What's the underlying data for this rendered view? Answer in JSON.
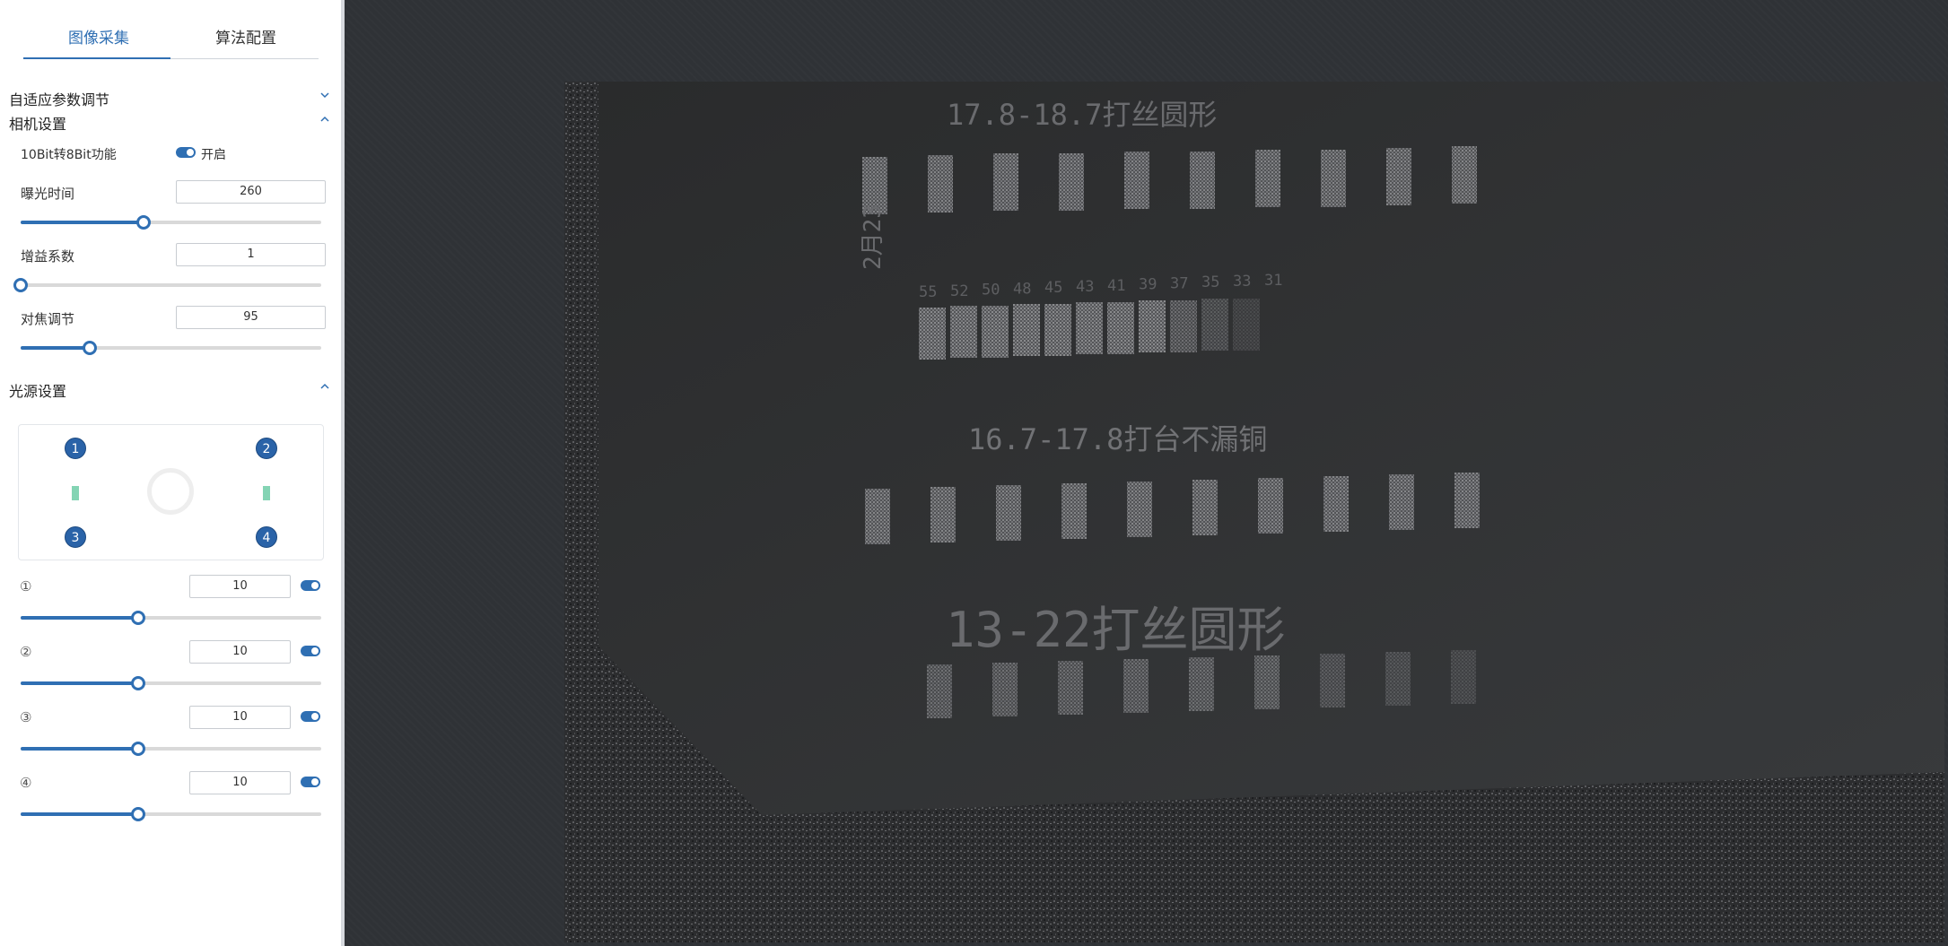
{
  "tabs": {
    "acquisition": "图像采集",
    "algorithm": "算法配置",
    "active": "acquisition"
  },
  "sections": {
    "adaptive": {
      "title": "自适应参数调节",
      "expanded": false
    },
    "camera": {
      "title": "相机设置",
      "expanded": true
    },
    "light": {
      "title": "光源设置",
      "expanded": true
    }
  },
  "camera": {
    "bit_convert_label": "10Bit转8Bit功能",
    "bit_convert_state": "开启",
    "exposure": {
      "label": "曝光时间",
      "value": "260",
      "fraction": 0.41
    },
    "gain": {
      "label": "增益系数",
      "value": "1",
      "fraction": 0.0
    },
    "focus": {
      "label": "对焦调节",
      "value": "95",
      "fraction": 0.23
    }
  },
  "light": {
    "badges": [
      "1",
      "2",
      "3",
      "4"
    ],
    "channels": [
      {
        "label": "①",
        "value": "10",
        "enabled": true,
        "fraction": 0.39
      },
      {
        "label": "②",
        "value": "10",
        "enabled": true,
        "fraction": 0.39
      },
      {
        "label": "③",
        "value": "10",
        "enabled": true,
        "fraction": 0.39
      },
      {
        "label": "④",
        "value": "10",
        "enabled": true,
        "fraction": 0.39
      }
    ]
  },
  "image_text": {
    "line1": "17.8-18.7打丝圆形",
    "date": "2月23",
    "numbers": [
      "55",
      "52",
      "50",
      "48",
      "45",
      "43",
      "41",
      "39",
      "37",
      "35",
      "33",
      "31"
    ],
    "line2": "16.7-17.8打台不漏铜",
    "line3": "13-22打丝圆形"
  },
  "colors": {
    "accent": "#2f6fb3",
    "light_bar": "#84d4b4",
    "viewer_bg": "#2f3236"
  }
}
